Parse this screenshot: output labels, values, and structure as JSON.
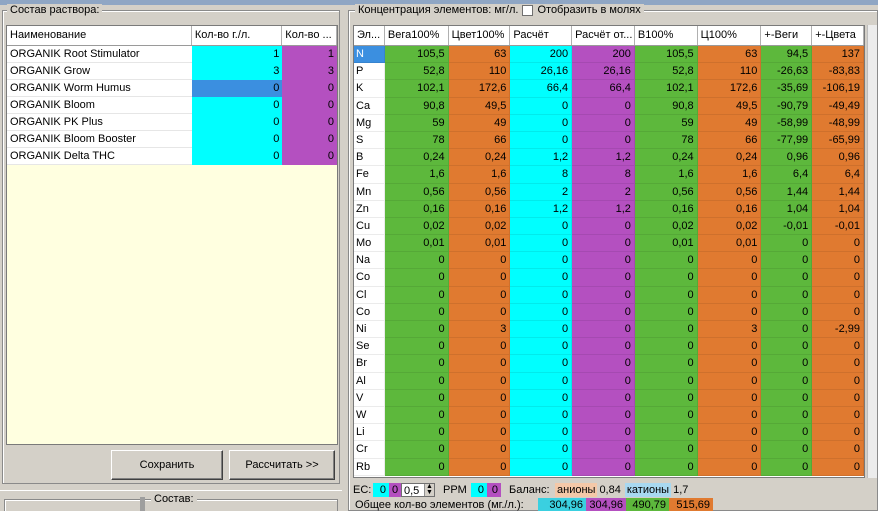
{
  "window": {
    "left_group_title": "Состав раствора:",
    "right_group_title": "Концентрация элементов: мг/л.",
    "moles_checkbox_label": "Отобразить в молях",
    "bottom_group_title": "Состав:"
  },
  "recipe": {
    "columns": [
      "Наименование",
      "Кол-во г./л.",
      "Кол-во ..."
    ],
    "rows": [
      {
        "name": "ORGANIK Root Stimulator",
        "qty1": "1",
        "qty2": "1"
      },
      {
        "name": "ORGANIK Grow",
        "qty1": "3",
        "qty2": "3"
      },
      {
        "name": "ORGANIK Worm Humus",
        "qty1": "0",
        "qty2": "0"
      },
      {
        "name": "ORGANIK Bloom",
        "qty1": "0",
        "qty2": "0"
      },
      {
        "name": "ORGANIK PK Plus",
        "qty1": "0",
        "qty2": "0"
      },
      {
        "name": "ORGANIK Bloom Booster",
        "qty1": "0",
        "qty2": "0"
      },
      {
        "name": "ORGANIK Delta THC",
        "qty1": "0",
        "qty2": "0"
      }
    ],
    "selected_row": 2
  },
  "buttons": {
    "save": "Сохранить",
    "calculate": "Рассчитать >>"
  },
  "concentration": {
    "columns": [
      "Эл...",
      "Вега100%",
      "Цвет100%",
      "Расчёт",
      "Расчёт от...",
      "В100%",
      "Ц100%",
      "+-Веги",
      "+-Цвета"
    ],
    "rows": [
      {
        "el": "N",
        "v": "105,5",
        "c": "63",
        "r": "200",
        "ro": "200",
        "b": "105,5",
        "cc": "63",
        "pv": "94,5",
        "pc": "137"
      },
      {
        "el": "P",
        "v": "52,8",
        "c": "110",
        "r": "26,16",
        "ro": "26,16",
        "b": "52,8",
        "cc": "110",
        "pv": "-26,63",
        "pc": "-83,83"
      },
      {
        "el": "K",
        "v": "102,1",
        "c": "172,6",
        "r": "66,4",
        "ro": "66,4",
        "b": "102,1",
        "cc": "172,6",
        "pv": "-35,69",
        "pc": "-106,19"
      },
      {
        "el": "Ca",
        "v": "90,8",
        "c": "49,5",
        "r": "0",
        "ro": "0",
        "b": "90,8",
        "cc": "49,5",
        "pv": "-90,79",
        "pc": "-49,49"
      },
      {
        "el": "Mg",
        "v": "59",
        "c": "49",
        "r": "0",
        "ro": "0",
        "b": "59",
        "cc": "49",
        "pv": "-58,99",
        "pc": "-48,99"
      },
      {
        "el": "S",
        "v": "78",
        "c": "66",
        "r": "0",
        "ro": "0",
        "b": "78",
        "cc": "66",
        "pv": "-77,99",
        "pc": "-65,99"
      },
      {
        "el": "B",
        "v": "0,24",
        "c": "0,24",
        "r": "1,2",
        "ro": "1,2",
        "b": "0,24",
        "cc": "0,24",
        "pv": "0,96",
        "pc": "0,96"
      },
      {
        "el": "Fe",
        "v": "1,6",
        "c": "1,6",
        "r": "8",
        "ro": "8",
        "b": "1,6",
        "cc": "1,6",
        "pv": "6,4",
        "pc": "6,4"
      },
      {
        "el": "Mn",
        "v": "0,56",
        "c": "0,56",
        "r": "2",
        "ro": "2",
        "b": "0,56",
        "cc": "0,56",
        "pv": "1,44",
        "pc": "1,44"
      },
      {
        "el": "Zn",
        "v": "0,16",
        "c": "0,16",
        "r": "1,2",
        "ro": "1,2",
        "b": "0,16",
        "cc": "0,16",
        "pv": "1,04",
        "pc": "1,04"
      },
      {
        "el": "Cu",
        "v": "0,02",
        "c": "0,02",
        "r": "0",
        "ro": "0",
        "b": "0,02",
        "cc": "0,02",
        "pv": "-0,01",
        "pc": "-0,01"
      },
      {
        "el": "Mo",
        "v": "0,01",
        "c": "0,01",
        "r": "0",
        "ro": "0",
        "b": "0,01",
        "cc": "0,01",
        "pv": "0",
        "pc": "0"
      },
      {
        "el": "Na",
        "v": "0",
        "c": "0",
        "r": "0",
        "ro": "0",
        "b": "0",
        "cc": "0",
        "pv": "0",
        "pc": "0"
      },
      {
        "el": "Co",
        "v": "0",
        "c": "0",
        "r": "0",
        "ro": "0",
        "b": "0",
        "cc": "0",
        "pv": "0",
        "pc": "0"
      },
      {
        "el": "Cl",
        "v": "0",
        "c": "0",
        "r": "0",
        "ro": "0",
        "b": "0",
        "cc": "0",
        "pv": "0",
        "pc": "0"
      },
      {
        "el": "Co",
        "v": "0",
        "c": "0",
        "r": "0",
        "ro": "0",
        "b": "0",
        "cc": "0",
        "pv": "0",
        "pc": "0"
      },
      {
        "el": "Ni",
        "v": "0",
        "c": "3",
        "r": "0",
        "ro": "0",
        "b": "0",
        "cc": "3",
        "pv": "0",
        "pc": "-2,99"
      },
      {
        "el": "Se",
        "v": "0",
        "c": "0",
        "r": "0",
        "ro": "0",
        "b": "0",
        "cc": "0",
        "pv": "0",
        "pc": "0"
      },
      {
        "el": "Br",
        "v": "0",
        "c": "0",
        "r": "0",
        "ro": "0",
        "b": "0",
        "cc": "0",
        "pv": "0",
        "pc": "0"
      },
      {
        "el": "Al",
        "v": "0",
        "c": "0",
        "r": "0",
        "ro": "0",
        "b": "0",
        "cc": "0",
        "pv": "0",
        "pc": "0"
      },
      {
        "el": "V",
        "v": "0",
        "c": "0",
        "r": "0",
        "ro": "0",
        "b": "0",
        "cc": "0",
        "pv": "0",
        "pc": "0"
      },
      {
        "el": "W",
        "v": "0",
        "c": "0",
        "r": "0",
        "ro": "0",
        "b": "0",
        "cc": "0",
        "pv": "0",
        "pc": "0"
      },
      {
        "el": "Li",
        "v": "0",
        "c": "0",
        "r": "0",
        "ro": "0",
        "b": "0",
        "cc": "0",
        "pv": "0",
        "pc": "0"
      },
      {
        "el": "Cr",
        "v": "0",
        "c": "0",
        "r": "0",
        "ro": "0",
        "b": "0",
        "cc": "0",
        "pv": "0",
        "pc": "0"
      },
      {
        "el": "Rb",
        "v": "0",
        "c": "0",
        "r": "0",
        "ro": "0",
        "b": "0",
        "cc": "0",
        "pv": "0",
        "pc": "0"
      }
    ],
    "selected_row": 0
  },
  "ec": {
    "label": "EC:",
    "val1": "0",
    "val2": "0",
    "spin_value": "0,5",
    "ppm_label": "PPM",
    "ppm1": "0",
    "ppm2": "0",
    "balance_label": "Баланс:",
    "anions_label": "анионы",
    "anions_value": "0,84",
    "cations_label": "катионы",
    "cations_value": "1,7"
  },
  "totals": {
    "label": "Общее кол-во элементов (мг./л.):",
    "t1": "304,96",
    "t2": "304,96",
    "t3": "490,79",
    "t4": "515,69"
  },
  "colors": {
    "cyan": "#00ffff",
    "purple": "#b450c0",
    "green": "#5db83c",
    "orange": "#e07a30",
    "selection": "#3b8fe0",
    "panel_bg": "#d4d0c8",
    "recipe_bg": "#ffffe0",
    "anions_bg": "#f4c8a8",
    "cations_bg": "#a8d8f0",
    "total_cyan": "#3ad0e0"
  }
}
